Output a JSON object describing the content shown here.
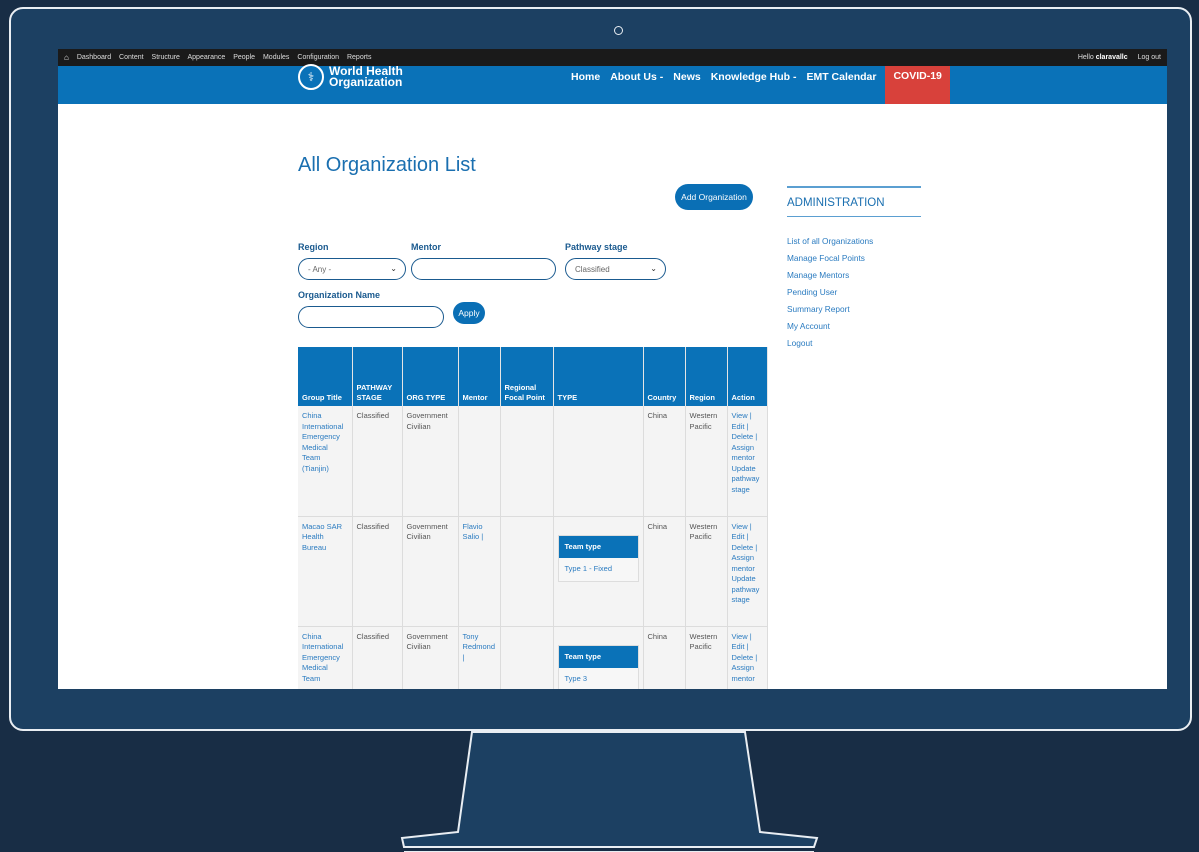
{
  "admin_bar": {
    "menu": [
      "Dashboard",
      "Content",
      "Structure",
      "Appearance",
      "People",
      "Modules",
      "Configuration",
      "Reports"
    ],
    "greeting_prefix": "Hello",
    "username": "claravallc",
    "logout": "Log out"
  },
  "header": {
    "logo_line1": "World Health",
    "logo_line2": "Organization",
    "nav": [
      "Home",
      "About Us -",
      "News",
      "Knowledge Hub -",
      "EMT Calendar"
    ],
    "covid": "COVID-19"
  },
  "page": {
    "title": "All Organization List",
    "add_button": "Add Organization"
  },
  "filters": {
    "region_label": "Region",
    "region_value": "- Any -",
    "mentor_label": "Mentor",
    "mentor_value": "",
    "pathway_label": "Pathway stage",
    "pathway_value": "Classified",
    "org_name_label": "Organization Name",
    "org_name_value": "",
    "apply": "Apply"
  },
  "table": {
    "headers": [
      "Group Title",
      "PATHWAY STAGE",
      "ORG TYPE",
      "Mentor",
      "Regional Focal Point",
      "TYPE",
      "Country",
      "Region",
      "Action"
    ],
    "team_type_label": "Team type",
    "rows": [
      {
        "group_title": "China International Emergency Medical Team (Tianjin)",
        "pathway_stage": "Classified",
        "org_type": "Government Civilian",
        "mentor": "",
        "focal_point": "",
        "team_type": "",
        "country": "China",
        "region": "Western Pacific",
        "actions": "View | Edit | Delete | Assign mentor Update pathway stage"
      },
      {
        "group_title": "Macao SAR Health Bureau",
        "pathway_stage": "Classified",
        "org_type": "Government Civilian",
        "mentor": "Flavio Salio |",
        "focal_point": "",
        "team_type": "Type 1 - Fixed",
        "country": "China",
        "region": "Western Pacific",
        "actions": "View | Edit | Delete | Assign mentor Update pathway stage"
      },
      {
        "group_title": "China International Emergency Medical Team",
        "pathway_stage": "Classified",
        "org_type": "Government Civilian",
        "mentor": "Tony Redmond |",
        "focal_point": "",
        "team_type": "Type 3",
        "country": "China",
        "region": "Western Pacific",
        "actions": "View | Edit | Delete | Assign mentor"
      }
    ]
  },
  "sidebar": {
    "title": "ADMINISTRATION",
    "links": [
      "List of all Organizations",
      "Manage Focal Points",
      "Manage Mentors",
      "Pending User",
      "Summary Report",
      "My Account",
      "Logout"
    ]
  }
}
